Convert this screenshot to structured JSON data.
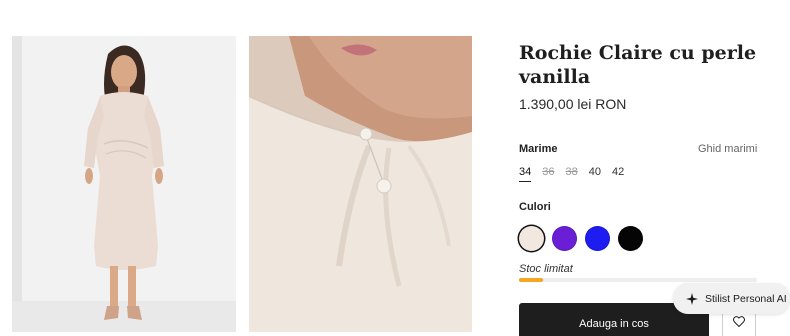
{
  "product": {
    "title": "Rochie Claire cu perle vanilla",
    "price": "1.390,00 lei RON"
  },
  "size_section": {
    "label": "Marime",
    "guide_label": "Ghid marimi",
    "sizes": [
      {
        "label": "34",
        "state": "selected"
      },
      {
        "label": "36",
        "state": "unavailable"
      },
      {
        "label": "38",
        "state": "unavailable"
      },
      {
        "label": "40",
        "state": "available"
      },
      {
        "label": "42",
        "state": "available"
      }
    ]
  },
  "color_section": {
    "label": "Culori",
    "swatches": [
      {
        "name": "vanilla",
        "color": "#f3e8e0",
        "selected": true
      },
      {
        "name": "purple",
        "color": "#6a1fd6",
        "selected": false
      },
      {
        "name": "blue",
        "color": "#1d1df2",
        "selected": false
      },
      {
        "name": "black",
        "color": "#050505",
        "selected": false
      }
    ]
  },
  "stock": {
    "label": "Stoc limitat",
    "level": 0.1,
    "bar_color": "#f5a623"
  },
  "actions": {
    "add_to_cart_label": "Adauga in cos",
    "wishlist_icon": "heart-icon"
  },
  "assistant": {
    "label": "Stilist Personal AI",
    "icon": "sparkle-icon"
  },
  "images": [
    {
      "name": "product-image-full-length"
    },
    {
      "name": "product-image-pearl-detail"
    }
  ]
}
